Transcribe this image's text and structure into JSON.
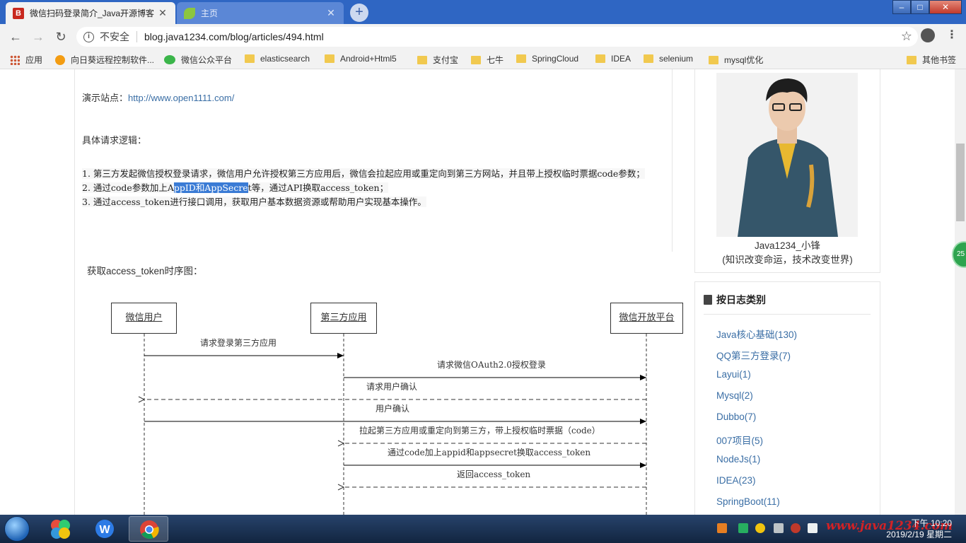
{
  "browser": {
    "tabs": [
      {
        "title": "微信扫码登录简介_Java开源博客",
        "favicon": "B",
        "active": true
      },
      {
        "title": "主页",
        "favicon": "leaf-icon",
        "active": false
      }
    ],
    "address": {
      "security": "不安全",
      "url": "blog.java1234.com/blog/articles/494.html"
    },
    "bookmarks": [
      {
        "label": "应用",
        "icon": "apps-icon"
      },
      {
        "label": "向日葵远程控制软件...",
        "icon": "sunflower-icon"
      },
      {
        "label": "微信公众平台",
        "icon": "wechat-icon"
      },
      {
        "label": "elasticsearch",
        "icon": "folder-icon"
      },
      {
        "label": "Android+Html5",
        "icon": "folder-icon"
      },
      {
        "label": "支付宝",
        "icon": "folder-icon"
      },
      {
        "label": "七牛",
        "icon": "folder-icon"
      },
      {
        "label": "SpringCloud",
        "icon": "folder-icon"
      },
      {
        "label": "IDEA",
        "icon": "folder-icon"
      },
      {
        "label": "selenium",
        "icon": "folder-icon"
      },
      {
        "label": "mysql优化",
        "icon": "folder-icon"
      },
      {
        "label": "其他书签",
        "icon": "folder-icon"
      }
    ]
  },
  "article": {
    "demo_label": "演示站点：",
    "demo_link": "http://www.open1111.com/",
    "logic_title": "具体请求逻辑：",
    "steps": {
      "s1": "1. 第三方发起微信授权登录请求，微信用户允许授权第三方应用后，微信会拉起应用或重定向到第三方网站，并且带上授权临时票据code参数；",
      "s2_pre": "2. 通过code参数加上A",
      "s2_hl": "ppID和AppSecre",
      "s2_post": "t等，通过API换取access_token；",
      "s3": "3. 通过access_token进行接口调用，获取用户基本数据资源或帮助用户实现基本操作。"
    },
    "seq_title": "获取access_token时序图：",
    "diagram": {
      "actors": [
        "微信用户",
        "第三方应用",
        "微信开放平台"
      ],
      "messages": [
        "请求登录第三方应用",
        "请求微信OAuth2.0授权登录",
        "请求用户确认",
        "用户确认",
        "拉起第三方应用或重定向到第三方，带上授权临时票据（code）",
        "通过code加上appid和appsecret换取access_token",
        "返回access_token"
      ]
    }
  },
  "sidebar": {
    "author_name": "Java1234_小锋",
    "author_motto": "(知识改变命运，技术改变世界)",
    "category_title": "按日志类别",
    "categories": [
      "Java核心基础(130)",
      "QQ第三方登录(7)",
      "Layui(1)",
      "Mysql(2)",
      "Dubbo(7)",
      "007项目(5)",
      "NodeJs(1)",
      "IDEA(23)",
      "SpringBoot(11)"
    ],
    "badge": "25"
  },
  "taskbar": {
    "watermark": "www.java1234.com",
    "time": "下午 10:20",
    "date": "2019/2/19 星期二"
  },
  "colors": {
    "tabstrip": "#2f66c3",
    "link": "#3a6ea5",
    "selection": "#3a7bd5"
  }
}
